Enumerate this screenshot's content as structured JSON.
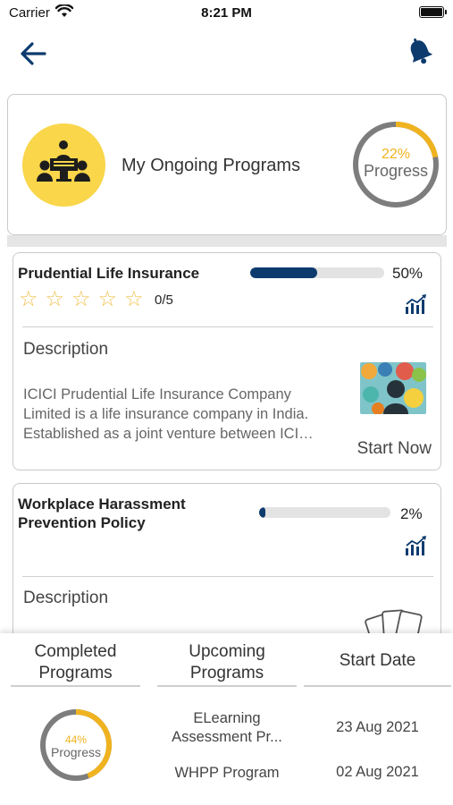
{
  "status_bar": {
    "carrier": "Carrier",
    "time": "8:21 PM"
  },
  "header": {
    "title": "My Ongoing Programs",
    "progress_percent": "22%",
    "progress_label": "Progress",
    "progress_value": 0.22
  },
  "programs": [
    {
      "title_lines": [
        "Prudential Life Insurance"
      ],
      "progress_text": "50%",
      "progress_value": 0.5,
      "stars_total": 5,
      "stars_filled": 0,
      "rating_text": "0/5",
      "description_heading": "Description",
      "description_lines": [
        "ICICI Prudential Life Insurance Company",
        "Limited is a life insurance company in India.",
        "Established as a joint venture between ICI…"
      ],
      "action_label": "Start Now"
    },
    {
      "title_lines": [
        "Workplace Harassment",
        "Prevention Policy"
      ],
      "progress_text": "2%",
      "progress_value": 0.02,
      "description_heading": "Description"
    }
  ],
  "bottom": {
    "completed_header": [
      "Completed",
      "Programs"
    ],
    "upcoming_header": [
      "Upcoming",
      "Programs"
    ],
    "start_date_header": "Start Date",
    "completed_percent": "44%",
    "completed_label": "Progress",
    "completed_value": 0.44,
    "upcoming": [
      {
        "name_lines": [
          "ELearning",
          "Assessment Pr..."
        ],
        "date": "23 Aug 2021"
      },
      {
        "name_lines": [
          "WHPP Program"
        ],
        "date": "02 Aug 2021"
      }
    ]
  },
  "colors": {
    "navy": "#0d3b6e",
    "accent_yellow": "#f9d64a",
    "progress_orange": "#f0b320",
    "ring_gray": "#7d7d7d"
  },
  "icons": [
    "back-arrow-icon",
    "bell-icon",
    "meeting-icon",
    "star-icon",
    "bar-chart-icon",
    "cards-icon",
    "wifi-icon",
    "battery-icon"
  ]
}
